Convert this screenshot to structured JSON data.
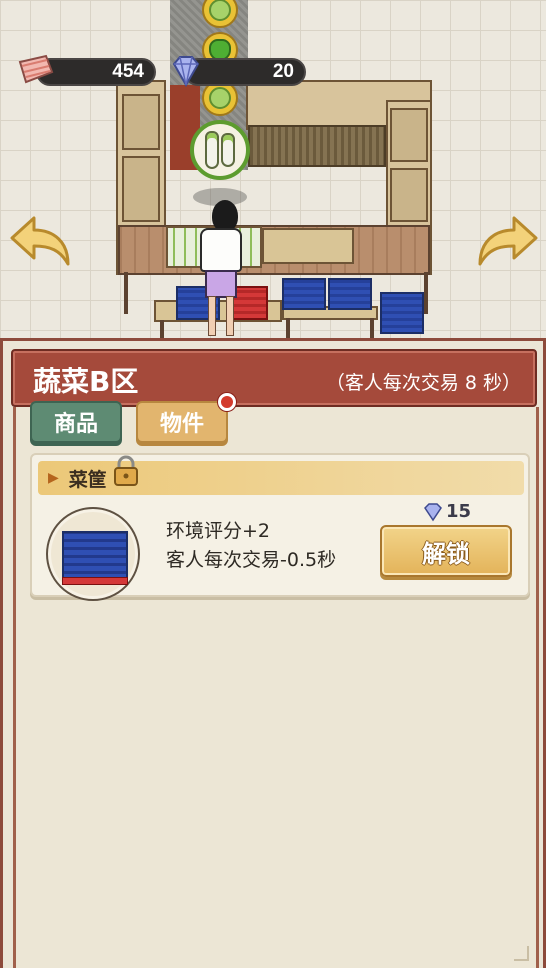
{
  "hud": {
    "meat_count": "454",
    "gem_count": "20",
    "meat_icon": "meat-icon",
    "gem_icon": "diamond-icon"
  },
  "scene": {
    "queue_items": [
      "cabbage-icon",
      "pepper-icon",
      "cabbage-icon"
    ],
    "focus_item": "radish-icon",
    "left_arrow": "curved-arrow-left-icon",
    "right_arrow": "curved-arrow-right-icon"
  },
  "panel": {
    "title": "蔬菜B区",
    "subtitle": "（客人每次交易 8 秒）",
    "tabs": [
      {
        "label": "商品",
        "active": false
      },
      {
        "label": "物件",
        "active": true,
        "notification": true
      }
    ],
    "card": {
      "title": "菜筐",
      "desc_line1": "环境评分+2",
      "desc_line2": "客人每次交易-0.5秒",
      "cost": "15",
      "unlock_label": "解锁",
      "locked": true
    }
  },
  "colors": {
    "header": "#a54a3b",
    "tab_goods": "#5e8b73",
    "tab_items": "#e2b56e",
    "unlock_button": "#e9c06a",
    "badge": "#d33a2c"
  }
}
